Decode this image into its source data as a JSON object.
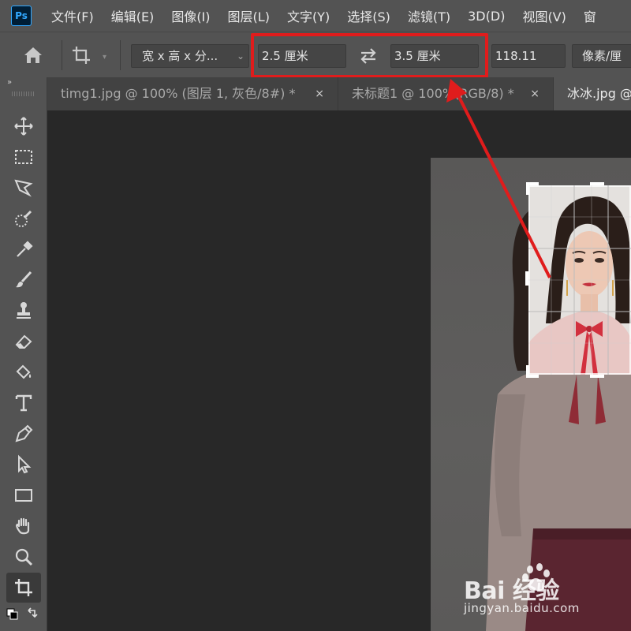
{
  "app": {
    "logo_text": "Ps"
  },
  "menu": [
    "文件(F)",
    "编辑(E)",
    "图像(I)",
    "图层(L)",
    "文字(Y)",
    "选择(S)",
    "滤镜(T)",
    "3D(D)",
    "视图(V)",
    "窗"
  ],
  "options": {
    "ratio_preset": "宽 x 高 x 分...",
    "width_value": "2.5 厘米",
    "height_value": "3.5 厘米",
    "resolution_value": "118.11",
    "resolution_unit": "像素/厘"
  },
  "tabs": [
    {
      "label": "timg1.jpg @ 100% (图层 1, 灰色/8#) *",
      "close": "×"
    },
    {
      "label": "未标题1 @ 100%(RGB/8) *",
      "close": "×"
    },
    {
      "label": "冰冰.jpg @",
      "close": ""
    }
  ],
  "toolbar": {
    "collapse": "»"
  },
  "watermark": {
    "logo": "Bai 经验",
    "url": "jingyan.baidu.com"
  },
  "colors": {
    "highlight": "#e01c1c",
    "ps_blue": "#31a8ff",
    "panel": "#535353",
    "workspace": "#282828"
  }
}
